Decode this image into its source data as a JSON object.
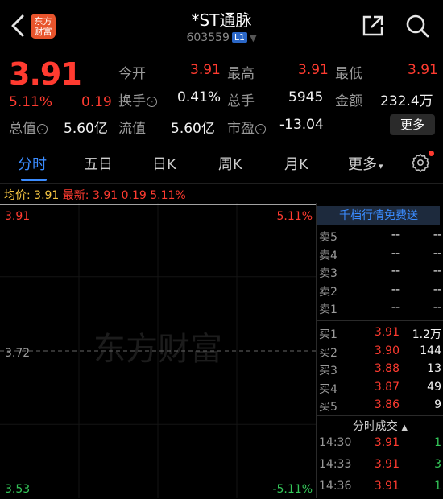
{
  "header": {
    "title": "*ST通脉",
    "code": "603559",
    "market_badge": "L1",
    "logo_line1": "东方",
    "logo_line2": "财富"
  },
  "quote": {
    "price": "3.91",
    "change_pct": "5.11%",
    "change": "0.19",
    "rows": [
      [
        {
          "label": "今开",
          "value": "3.91",
          "color": "red"
        },
        {
          "label": "最高",
          "value": "3.91",
          "color": "red"
        },
        {
          "label": "最低",
          "value": "3.91",
          "color": "red"
        }
      ],
      [
        {
          "label": "换手",
          "value": "0.41%",
          "color": "white"
        },
        {
          "label": "总手",
          "value": "5945",
          "color": "white"
        },
        {
          "label": "金额",
          "value": "232.4万",
          "color": "white"
        }
      ],
      [
        {
          "label": "总值",
          "value": "5.60亿",
          "color": "white"
        },
        {
          "label": "流值",
          "value": "5.60亿",
          "color": "white"
        },
        {
          "label": "市盈",
          "value": "-13.04",
          "color": "white"
        }
      ]
    ],
    "more_label": "更多"
  },
  "tabs": [
    "分时",
    "五日",
    "日K",
    "周K",
    "月K",
    "更多"
  ],
  "info_line": {
    "avg_label": "均价:",
    "avg_value": "3.91",
    "latest_label": "最新:",
    "latest_price": "3.91",
    "latest_change": "0.19",
    "latest_pct": "5.11%"
  },
  "chart": {
    "top_price": "3.91",
    "top_pct": "5.11%",
    "mid_price": "3.72",
    "bottom_price": "3.53",
    "bottom_pct": "-5.11%",
    "watermark": "东方财富"
  },
  "chart_data": {
    "type": "line",
    "title": "",
    "series": [
      {
        "values": [
          3.91,
          3.91,
          3.91,
          3.91
        ]
      }
    ],
    "ylim": [
      3.53,
      3.91
    ],
    "reference_price": 3.72,
    "grid": true
  },
  "orderbook": {
    "promo": "千档行情免费送",
    "asks": [
      {
        "label": "卖5",
        "price": "--",
        "vol": "--"
      },
      {
        "label": "卖4",
        "price": "--",
        "vol": "--"
      },
      {
        "label": "卖3",
        "price": "--",
        "vol": "--"
      },
      {
        "label": "卖2",
        "price": "--",
        "vol": "--"
      },
      {
        "label": "卖1",
        "price": "--",
        "vol": "--"
      }
    ],
    "bids": [
      {
        "label": "买1",
        "price": "3.91",
        "vol": "1.2万"
      },
      {
        "label": "买2",
        "price": "3.90",
        "vol": "144"
      },
      {
        "label": "买3",
        "price": "3.88",
        "vol": "13"
      },
      {
        "label": "买4",
        "price": "3.87",
        "vol": "49"
      },
      {
        "label": "买5",
        "price": "3.86",
        "vol": "9"
      }
    ],
    "trades_title": "分时成交",
    "trades": [
      {
        "time": "14:30",
        "price": "3.91",
        "vol": "1"
      },
      {
        "time": "14:33",
        "price": "3.91",
        "vol": "3"
      },
      {
        "time": "14:36",
        "price": "3.91",
        "vol": "1"
      }
    ]
  },
  "colors": {
    "up": "#ff3b30",
    "down": "#34c759",
    "accent": "#3b8cff",
    "avg": "#f5c542"
  }
}
